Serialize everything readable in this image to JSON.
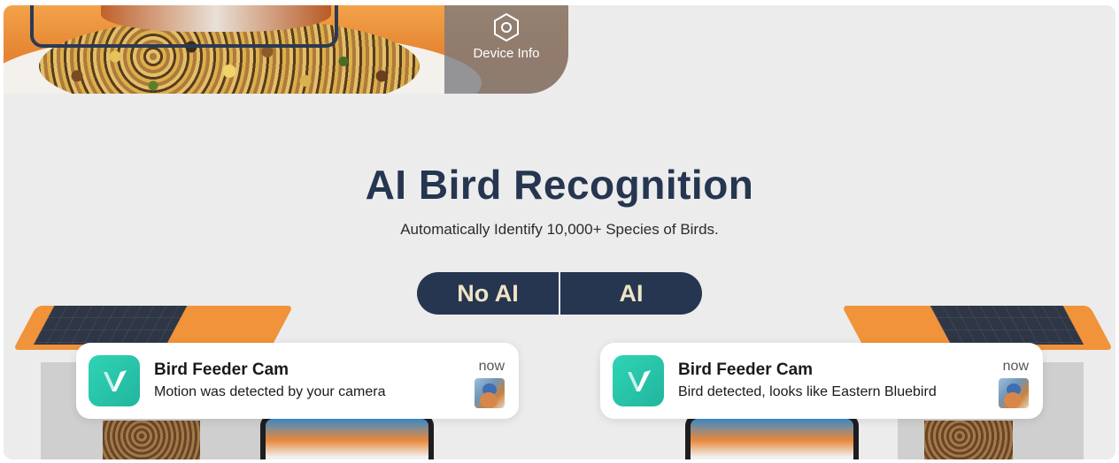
{
  "device_info": {
    "label": "Device Info",
    "icon": "hexagon-nut-icon"
  },
  "heading": {
    "title": "AI Bird Recognition",
    "subtitle": "Automatically Identify 10,000+ Species of Birds."
  },
  "toggle": {
    "options": [
      "No AI",
      "AI"
    ]
  },
  "notifications": [
    {
      "app_name": "Bird Feeder Cam",
      "message": "Motion was detected by your camera",
      "time": "now",
      "icon": "app-logo-v-icon",
      "thumbnail": "bluebird-thumbnail"
    },
    {
      "app_name": "Bird Feeder Cam",
      "message": "Bird detected, looks like Eastern Bluebird",
      "time": "now",
      "icon": "app-logo-v-icon",
      "thumbnail": "bluebird-thumbnail"
    }
  ],
  "colors": {
    "navy": "#263650",
    "toggle_text": "#efe4c6",
    "app_teal": "#2fd4b4",
    "background": "#ececec"
  }
}
